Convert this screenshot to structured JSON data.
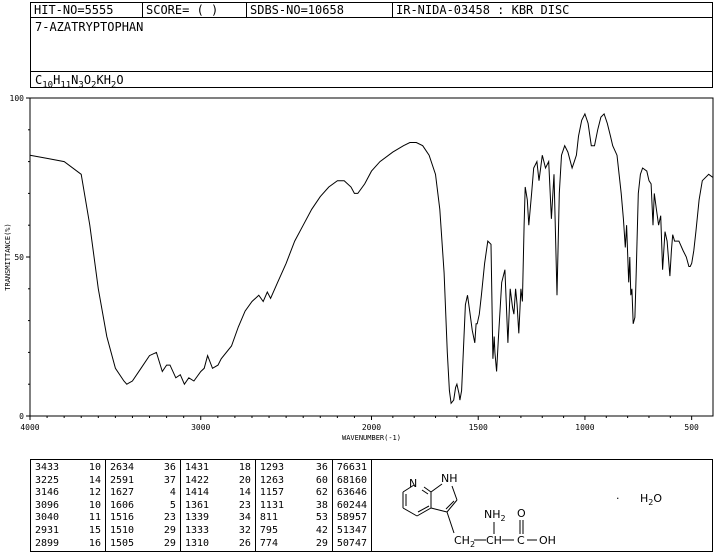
{
  "header": {
    "hit_no": "HIT-NO=5555",
    "score": "SCORE=  (  )",
    "sdbs_no": "SDBS-NO=10658",
    "ir_info": "IR-NIDA-03458 : KBR DISC",
    "compound_name": "7-AZATRYPTOPHAN",
    "formula": {
      "parts": [
        {
          "t": "C",
          "sub": false
        },
        {
          "t": "10",
          "sub": true
        },
        {
          "t": "H",
          "sub": false
        },
        {
          "t": "11",
          "sub": true
        },
        {
          "t": "N",
          "sub": false
        },
        {
          "t": "3",
          "sub": true
        },
        {
          "t": "O",
          "sub": false
        },
        {
          "t": "2",
          "sub": true
        },
        {
          "t": "KH",
          "sub": false
        },
        {
          "t": "2",
          "sub": true
        },
        {
          "t": "O",
          "sub": false
        }
      ]
    }
  },
  "chart_data": {
    "type": "line",
    "xlabel": "WAVENUMBER(-1)",
    "ylabel": "TRANSMITTANCE(%)",
    "xlim": [
      4000,
      400
    ],
    "ylim": [
      0,
      100
    ],
    "x_ticks": [
      4000,
      3000,
      2000,
      1500,
      1000,
      500
    ],
    "y_ticks": [
      0,
      50,
      100
    ],
    "grid": false,
    "series": [
      {
        "color": "#000000",
        "points": [
          [
            4000,
            82
          ],
          [
            3900,
            81
          ],
          [
            3800,
            80
          ],
          [
            3700,
            76
          ],
          [
            3650,
            60
          ],
          [
            3600,
            40
          ],
          [
            3550,
            25
          ],
          [
            3500,
            15
          ],
          [
            3450,
            11
          ],
          [
            3433,
            10
          ],
          [
            3400,
            11
          ],
          [
            3350,
            15
          ],
          [
            3300,
            19
          ],
          [
            3260,
            20
          ],
          [
            3225,
            14
          ],
          [
            3200,
            16
          ],
          [
            3180,
            16
          ],
          [
            3146,
            12
          ],
          [
            3120,
            13
          ],
          [
            3096,
            10
          ],
          [
            3070,
            12
          ],
          [
            3040,
            11
          ],
          [
            3000,
            14
          ],
          [
            2980,
            15
          ],
          [
            2960,
            19
          ],
          [
            2931,
            15
          ],
          [
            2899,
            16
          ],
          [
            2880,
            18
          ],
          [
            2820,
            22
          ],
          [
            2780,
            28
          ],
          [
            2740,
            33
          ],
          [
            2700,
            36
          ],
          [
            2660,
            38
          ],
          [
            2634,
            36
          ],
          [
            2610,
            39
          ],
          [
            2591,
            37
          ],
          [
            2550,
            42
          ],
          [
            2500,
            48
          ],
          [
            2450,
            55
          ],
          [
            2400,
            60
          ],
          [
            2350,
            65
          ],
          [
            2300,
            69
          ],
          [
            2250,
            72
          ],
          [
            2200,
            74
          ],
          [
            2160,
            74
          ],
          [
            2120,
            72
          ],
          [
            2100,
            70
          ],
          [
            2080,
            70
          ],
          [
            2040,
            73
          ],
          [
            2000,
            77
          ],
          [
            1960,
            80
          ],
          [
            1900,
            83
          ],
          [
            1850,
            85
          ],
          [
            1820,
            86
          ],
          [
            1790,
            86
          ],
          [
            1760,
            85
          ],
          [
            1730,
            82
          ],
          [
            1700,
            76
          ],
          [
            1680,
            65
          ],
          [
            1660,
            45
          ],
          [
            1645,
            20
          ],
          [
            1635,
            8
          ],
          [
            1627,
            4
          ],
          [
            1615,
            5
          ],
          [
            1606,
            9
          ],
          [
            1600,
            10
          ],
          [
            1590,
            7
          ],
          [
            1586,
            5
          ],
          [
            1578,
            8
          ],
          [
            1570,
            20
          ],
          [
            1560,
            35
          ],
          [
            1550,
            38
          ],
          [
            1540,
            33
          ],
          [
            1528,
            27
          ],
          [
            1516,
            23
          ],
          [
            1510,
            29
          ],
          [
            1505,
            29
          ],
          [
            1495,
            32
          ],
          [
            1485,
            38
          ],
          [
            1470,
            48
          ],
          [
            1455,
            55
          ],
          [
            1440,
            54
          ],
          [
            1431,
            18
          ],
          [
            1425,
            25
          ],
          [
            1422,
            20
          ],
          [
            1414,
            14
          ],
          [
            1405,
            25
          ],
          [
            1390,
            42
          ],
          [
            1375,
            46
          ],
          [
            1361,
            23
          ],
          [
            1350,
            40
          ],
          [
            1339,
            34
          ],
          [
            1333,
            32
          ],
          [
            1325,
            40
          ],
          [
            1318,
            35
          ],
          [
            1310,
            26
          ],
          [
            1300,
            40
          ],
          [
            1293,
            36
          ],
          [
            1285,
            60
          ],
          [
            1280,
            72
          ],
          [
            1270,
            68
          ],
          [
            1263,
            60
          ],
          [
            1250,
            70
          ],
          [
            1240,
            78
          ],
          [
            1225,
            80
          ],
          [
            1215,
            74
          ],
          [
            1200,
            82
          ],
          [
            1185,
            78
          ],
          [
            1170,
            80
          ],
          [
            1157,
            62
          ],
          [
            1145,
            76
          ],
          [
            1131,
            38
          ],
          [
            1120,
            70
          ],
          [
            1110,
            82
          ],
          [
            1095,
            85
          ],
          [
            1080,
            83
          ],
          [
            1060,
            78
          ],
          [
            1050,
            80
          ],
          [
            1040,
            82
          ],
          [
            1030,
            88
          ],
          [
            1015,
            93
          ],
          [
            1000,
            95
          ],
          [
            985,
            92
          ],
          [
            970,
            85
          ],
          [
            955,
            85
          ],
          [
            940,
            90
          ],
          [
            925,
            94
          ],
          [
            910,
            95
          ],
          [
            895,
            92
          ],
          [
            880,
            88
          ],
          [
            870,
            85
          ],
          [
            850,
            82
          ],
          [
            840,
            76
          ],
          [
            830,
            70
          ],
          [
            820,
            62
          ],
          [
            811,
            53
          ],
          [
            805,
            60
          ],
          [
            795,
            42
          ],
          [
            790,
            50
          ],
          [
            785,
            38
          ],
          [
            780,
            40
          ],
          [
            774,
            29
          ],
          [
            766,
            31
          ],
          [
            760,
            45
          ],
          [
            750,
            70
          ],
          [
            740,
            76
          ],
          [
            730,
            78
          ],
          [
            710,
            77
          ],
          [
            700,
            74
          ],
          [
            690,
            73
          ],
          [
            681,
            60
          ],
          [
            675,
            70
          ],
          [
            665,
            65
          ],
          [
            655,
            60
          ],
          [
            645,
            63
          ],
          [
            636,
            46
          ],
          [
            625,
            58
          ],
          [
            615,
            55
          ],
          [
            602,
            44
          ],
          [
            595,
            52
          ],
          [
            589,
            57
          ],
          [
            580,
            55
          ],
          [
            560,
            55
          ],
          [
            540,
            52
          ],
          [
            525,
            50
          ],
          [
            513,
            47
          ],
          [
            507,
            47
          ],
          [
            500,
            48
          ],
          [
            490,
            52
          ],
          [
            480,
            58
          ],
          [
            465,
            68
          ],
          [
            450,
            74
          ],
          [
            420,
            76
          ],
          [
            400,
            75
          ]
        ]
      }
    ]
  },
  "peaks": [
    [
      [
        "3433",
        "10"
      ],
      [
        "3225",
        "14"
      ],
      [
        "3146",
        "12"
      ],
      [
        "3096",
        "10"
      ],
      [
        "3040",
        "11"
      ],
      [
        "2931",
        "15"
      ],
      [
        "2899",
        "16"
      ]
    ],
    [
      [
        "2634",
        "36"
      ],
      [
        "2591",
        "37"
      ],
      [
        "1627",
        "4"
      ],
      [
        "1606",
        "5"
      ],
      [
        "1516",
        "23"
      ],
      [
        "1510",
        "29"
      ],
      [
        "1505",
        "29"
      ]
    ],
    [
      [
        "1431",
        "18"
      ],
      [
        "1422",
        "20"
      ],
      [
        "1414",
        "14"
      ],
      [
        "1361",
        "23"
      ],
      [
        "1339",
        "34"
      ],
      [
        "1333",
        "32"
      ],
      [
        "1310",
        "26"
      ]
    ],
    [
      [
        "1293",
        "36"
      ],
      [
        "1263",
        "60"
      ],
      [
        "1157",
        "62"
      ],
      [
        "1131",
        "38"
      ],
      [
        "811",
        "53"
      ],
      [
        "795",
        "42"
      ],
      [
        "774",
        "29"
      ]
    ],
    [
      [
        "766",
        "31"
      ],
      [
        "681",
        "60"
      ],
      [
        "636",
        "46"
      ],
      [
        "602",
        "44"
      ],
      [
        "589",
        "57"
      ],
      [
        "513",
        "47"
      ],
      [
        "507",
        "47"
      ]
    ]
  ],
  "structure": {
    "labels": {
      "n_ring": "N",
      "nh": "NH",
      "nh2": "NH2",
      "ch2": "CH2",
      "ch": "CH",
      "c": "C",
      "oh": "OH",
      "o": "O",
      "hydrate": "H2O",
      "dot": "·"
    }
  }
}
